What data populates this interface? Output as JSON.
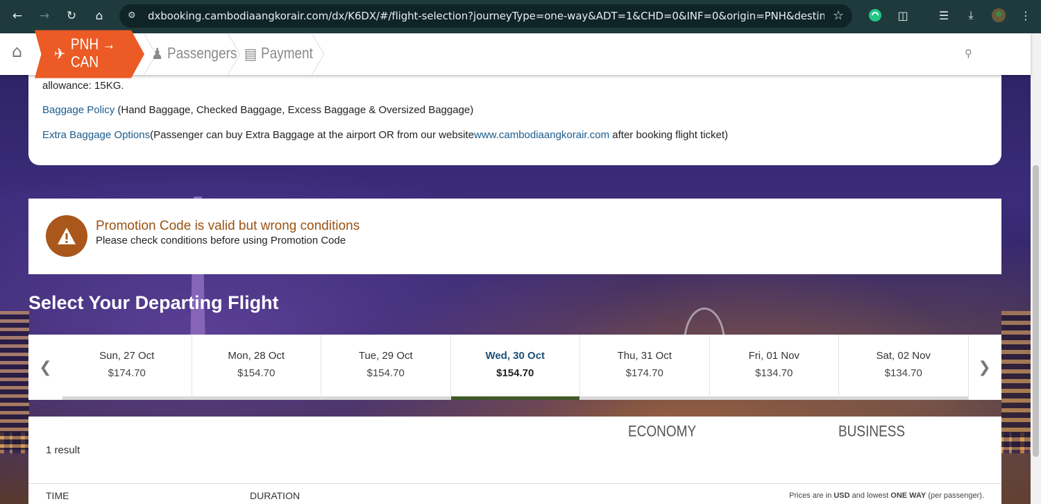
{
  "browser": {
    "url": "dxbooking.cambodiaangkorair.com/dx/K6DX/#/flight-selection?journeyType=one-way&ADT=1&CHD=0&INF=0&origin=PNH&destination=..."
  },
  "breadcrumb": {
    "route": "PNH → CAN",
    "passengers": "Passengers",
    "payment": "Payment"
  },
  "baggage": {
    "allowance_text": "allowance: 15KG.",
    "policy_link": "Baggage Policy",
    "policy_desc": " (Hand Baggage, Checked Baggage, Excess Baggage & Oversized Baggage)",
    "extra_link": "Extra Baggage Options",
    "extra_desc": "(Passenger can buy Extra Baggage at the airport OR from our website",
    "website_link": "www.cambodiaangkorair.com",
    "extra_tail": " after booking flight ticket)"
  },
  "promo": {
    "title": "Promotion Code is valid but wrong conditions",
    "subtitle": "Please check conditions before using Promotion Code"
  },
  "section_title": "Select Your Departing Flight",
  "dates": [
    {
      "day": "Sun, 27 Oct",
      "price": "$174.70",
      "selected": false
    },
    {
      "day": "Mon, 28 Oct",
      "price": "$154.70",
      "selected": false
    },
    {
      "day": "Tue, 29 Oct",
      "price": "$154.70",
      "selected": false
    },
    {
      "day": "Wed, 30 Oct",
      "price": "$154.70",
      "selected": true
    },
    {
      "day": "Thu, 31 Oct",
      "price": "$174.70",
      "selected": false
    },
    {
      "day": "Fri, 01 Nov",
      "price": "$134.70",
      "selected": false
    },
    {
      "day": "Sat, 02 Nov",
      "price": "$134.70",
      "selected": false
    }
  ],
  "results": {
    "count": "1 result",
    "economy": "ECONOMY",
    "business": "BUSINESS",
    "col_time": "TIME",
    "col_duration": "DURATION",
    "note_pre": "Prices are in ",
    "note_currency": "USD",
    "note_mid": " and lowest ",
    "note_way": "ONE WAY",
    "note_post": " (per passenger)."
  },
  "colors": {
    "accent": "#ec5b25",
    "link": "#1a5b8c",
    "warning": "#a9571b",
    "selected_bar": "#3f5a28"
  }
}
